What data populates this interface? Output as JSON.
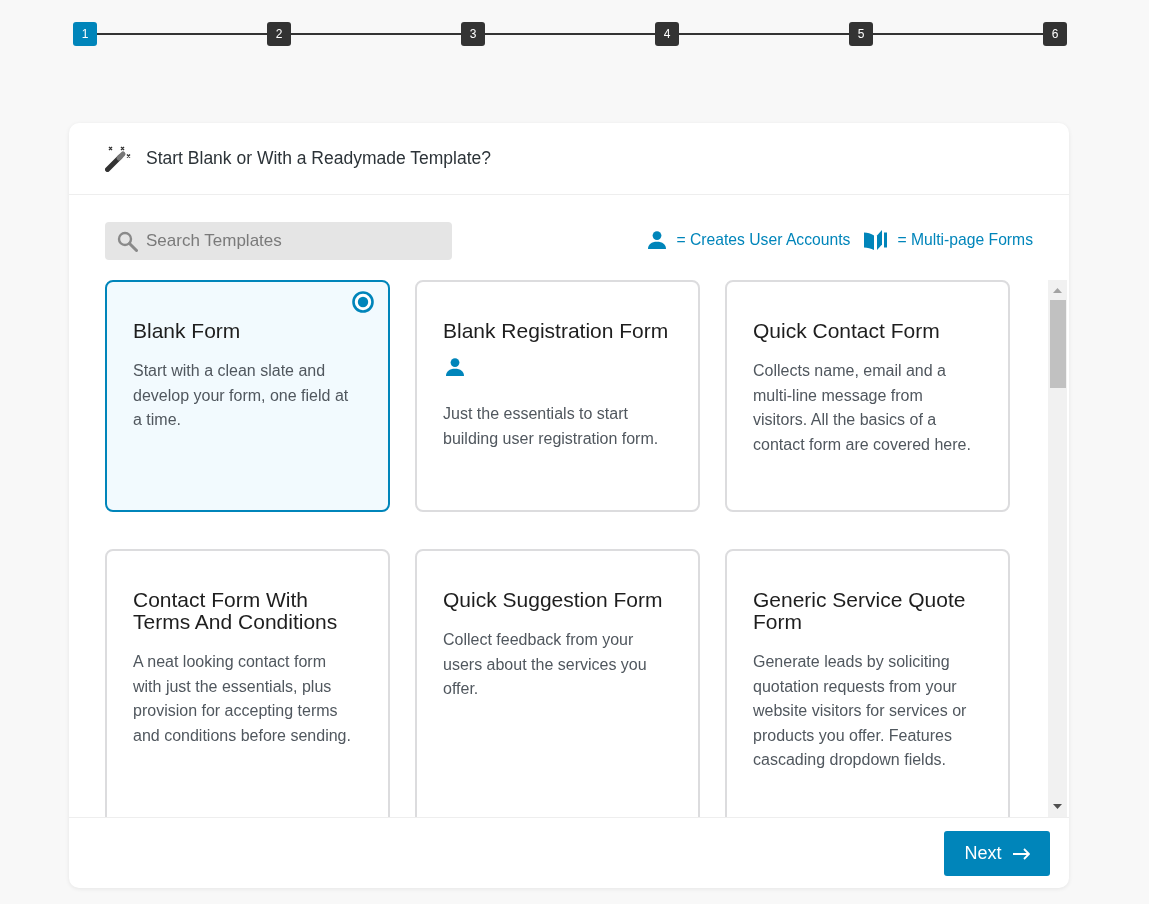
{
  "steps": [
    {
      "label": "1",
      "selected": true
    },
    {
      "label": "2",
      "selected": false
    },
    {
      "label": "3",
      "selected": false
    },
    {
      "label": "4",
      "selected": false
    },
    {
      "label": "5",
      "selected": false
    },
    {
      "label": "6",
      "selected": false
    }
  ],
  "header": {
    "title": "Start Blank or With a Readymade Template?"
  },
  "search": {
    "placeholder": "Search Templates"
  },
  "legend": [
    {
      "kind": "user",
      "text": "= Creates User Accounts"
    },
    {
      "kind": "pages",
      "text": "= Multi-page Forms"
    }
  ],
  "templates": [
    {
      "title": "Blank Form",
      "description": "Start with a clean slate and develop your form, one field at a time.",
      "selected": true,
      "creates_user_accounts": false
    },
    {
      "title": "Blank Registration Form",
      "description": "Just the essentials to start building user registration form.",
      "selected": false,
      "creates_user_accounts": true
    },
    {
      "title": "Quick Contact Form",
      "description": "Collects name, email and a multi-line message from visitors. All the basics of a contact form are covered here.",
      "selected": false,
      "creates_user_accounts": false
    },
    {
      "title": "Contact Form With Terms And Conditions",
      "description": "A neat looking contact form with just the essentials, plus provision for accepting terms and conditions before sending.",
      "selected": false,
      "creates_user_accounts": false
    },
    {
      "title": "Quick Suggestion Form",
      "description": "Collect feedback from your users about the services you offer.",
      "selected": false,
      "creates_user_accounts": false
    },
    {
      "title": "Generic Service Quote Form",
      "description": "Generate leads by soliciting quotation requests from your website visitors for services or products you offer. Features cascading dropdown fields.",
      "selected": false,
      "creates_user_accounts": false
    }
  ],
  "next_button": {
    "label": "Next"
  }
}
